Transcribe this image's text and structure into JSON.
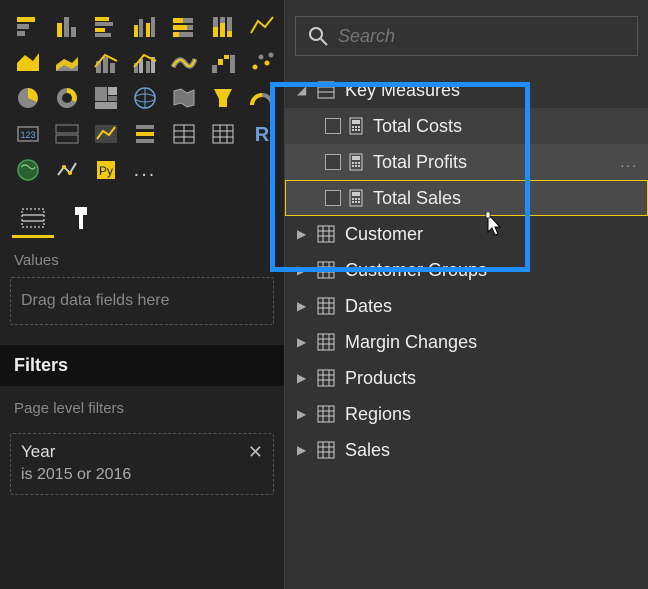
{
  "search": {
    "placeholder": "Search"
  },
  "tree": {
    "key_measures": {
      "label": "Key Measures",
      "children": [
        {
          "label": "Total Costs"
        },
        {
          "label": "Total Profits"
        },
        {
          "label": "Total Sales"
        }
      ]
    },
    "tables": [
      {
        "label": "Customer"
      },
      {
        "label": "Customer Groups"
      },
      {
        "label": "Dates"
      },
      {
        "label": "Margin Changes"
      },
      {
        "label": "Products"
      },
      {
        "label": "Regions"
      },
      {
        "label": "Sales"
      }
    ]
  },
  "left": {
    "values_label": "Values",
    "values_placeholder": "Drag data fields here",
    "filters_header": "Filters",
    "page_filters_label": "Page level filters",
    "filter": {
      "name": "Year",
      "desc": "is 2015 or 2016"
    },
    "more": "..."
  },
  "viz_icons": [
    "stacked-bar",
    "stacked-column",
    "clustered-bar",
    "clustered-column",
    "stacked-bar-100",
    "stacked-column-100",
    "line",
    "area",
    "stacked-area",
    "line-stacked-column",
    "line-clustered-column",
    "ribbon",
    "waterfall",
    "scatter",
    "pie",
    "donut",
    "treemap",
    "map",
    "filled-map",
    "funnel",
    "gauge",
    "card",
    "multi-card",
    "kpi",
    "slicer",
    "table",
    "matrix",
    "r-visual",
    "arcgis",
    "python",
    "",
    "",
    "",
    "",
    ""
  ],
  "viz_more": "..."
}
